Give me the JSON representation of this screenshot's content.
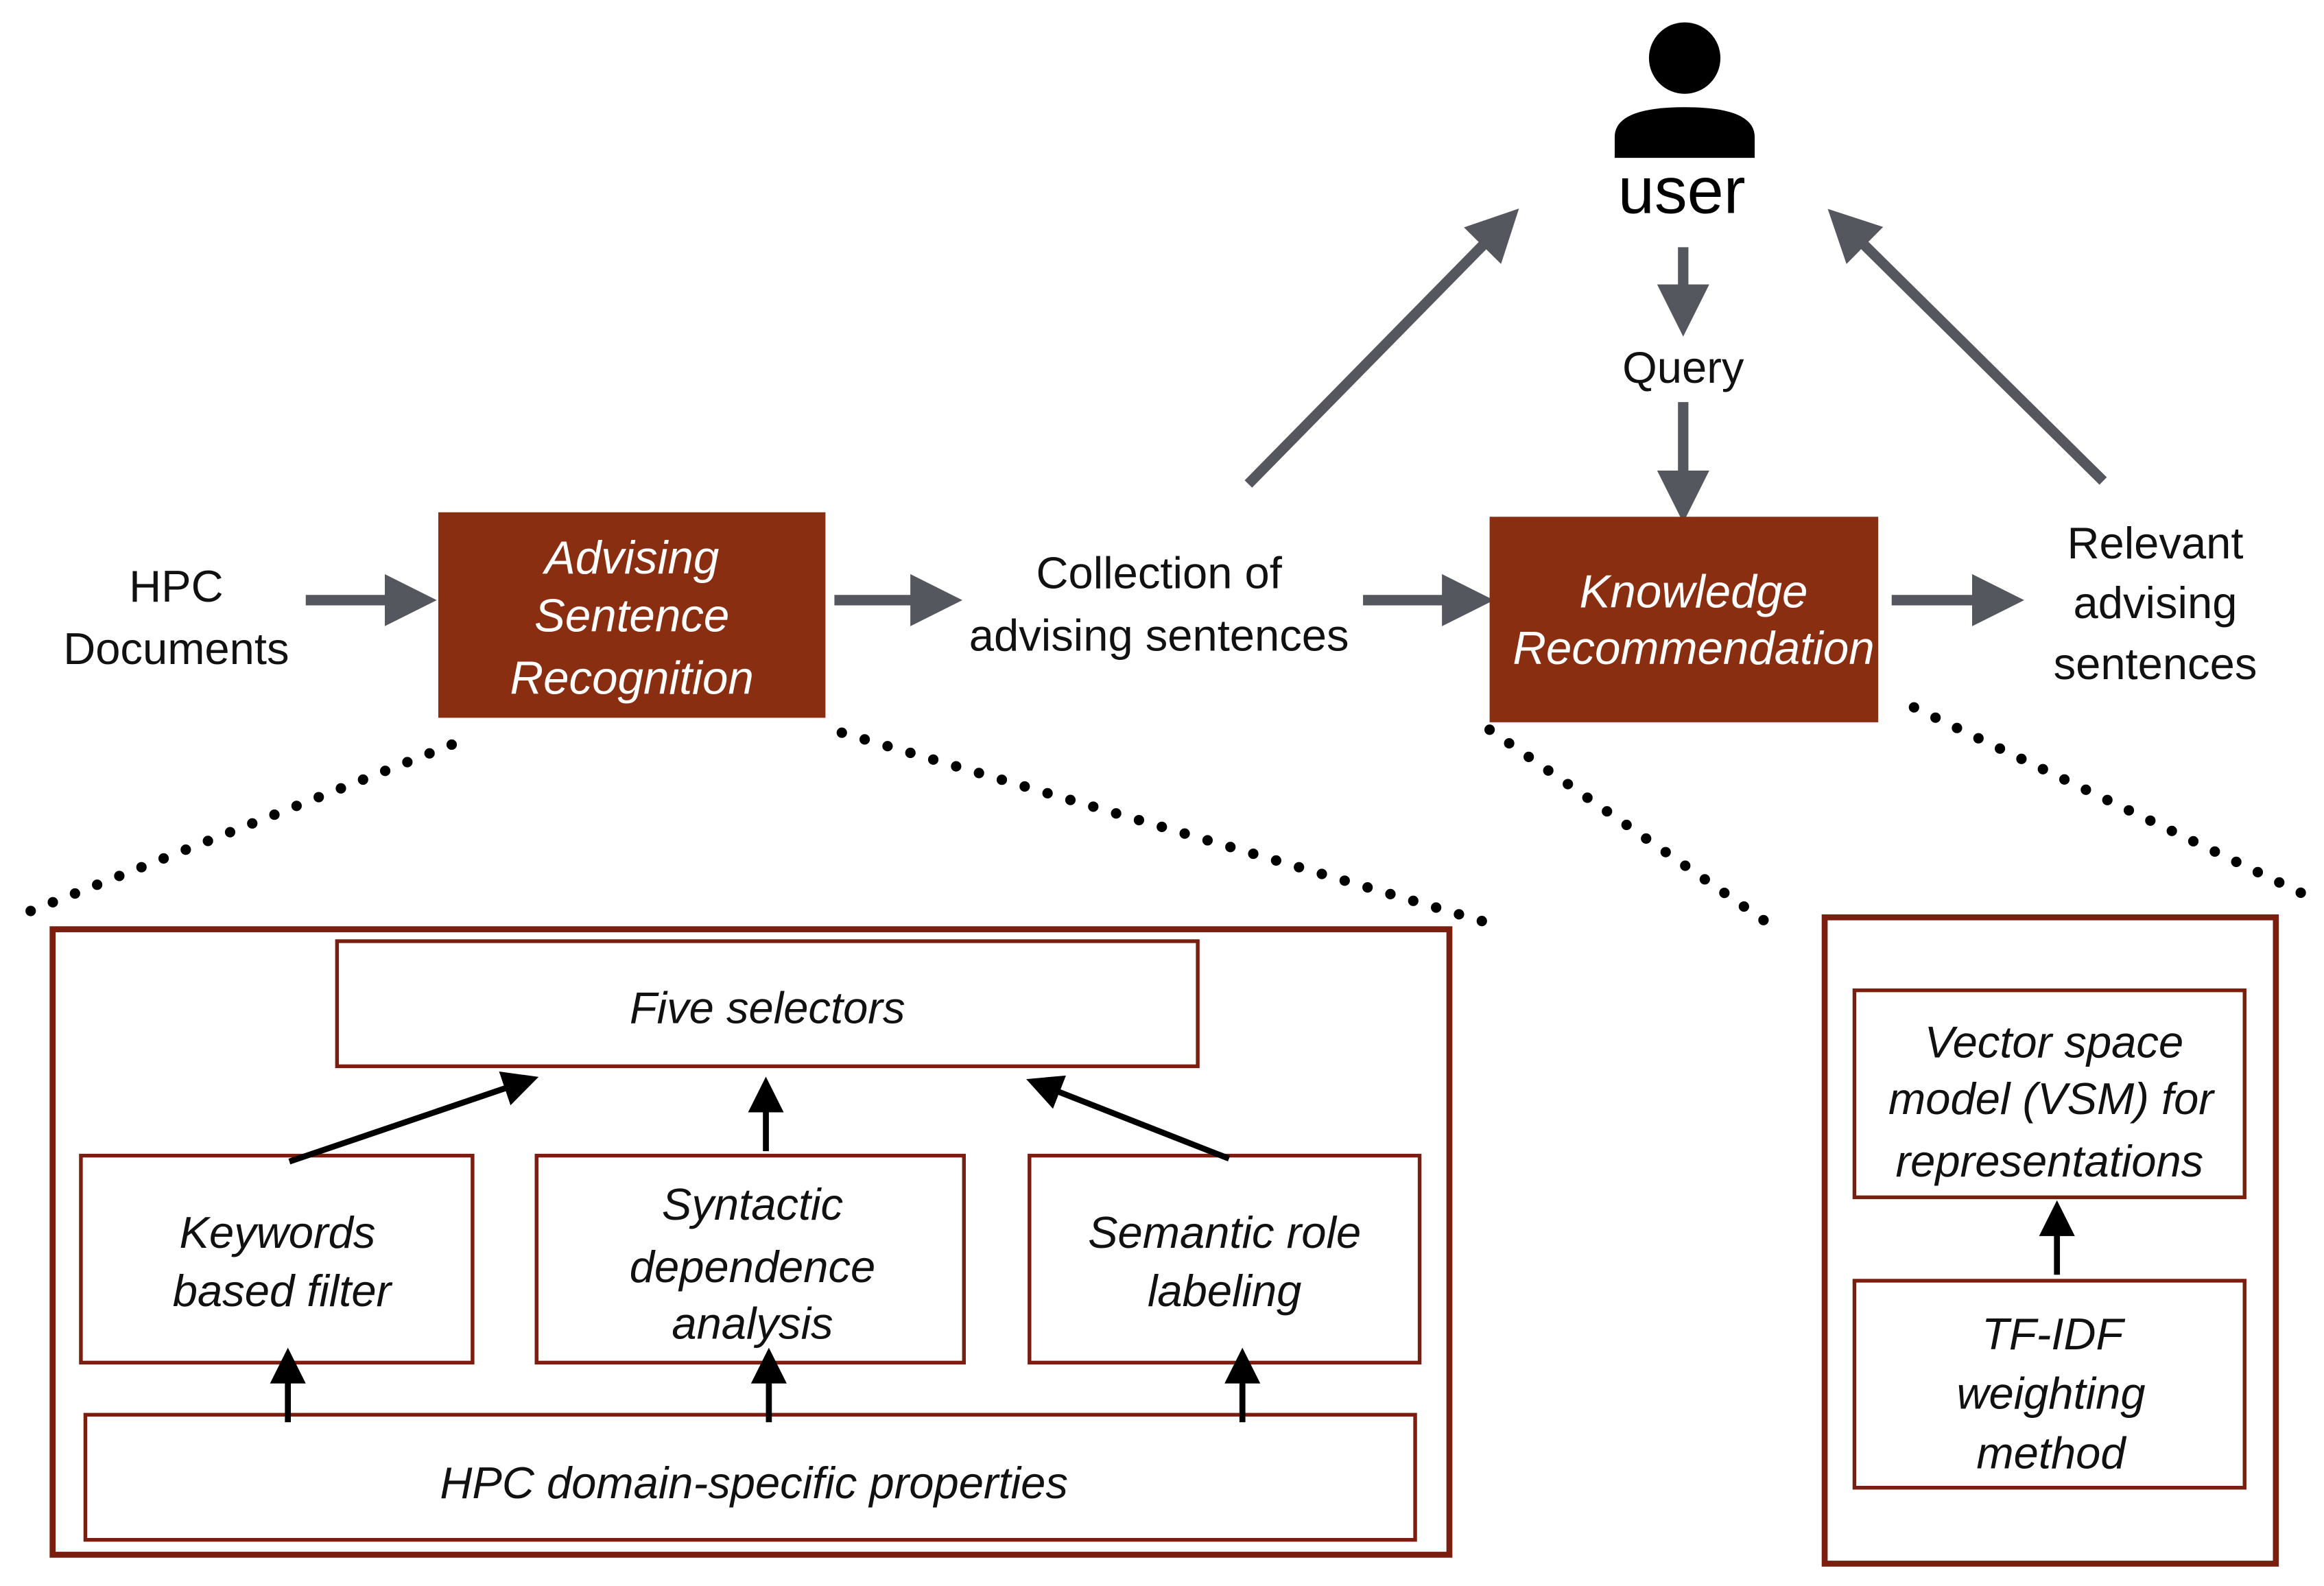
{
  "colors": {
    "process_box": "#8a2e12",
    "arrow_gray": "#54575e",
    "border": "#7a1f10"
  },
  "user": {
    "icon": "person-icon",
    "label": "user",
    "query_label": "Query"
  },
  "inputs": {
    "hpc_documents": [
      "HPC",
      "Documents"
    ]
  },
  "asr": {
    "label": [
      "Advising",
      "Sentence",
      "Recognition"
    ]
  },
  "collection": {
    "label": [
      "Collection of",
      "advising sentences"
    ]
  },
  "kr": {
    "label": [
      "Knowledge",
      "Recommendation"
    ]
  },
  "output": {
    "label": [
      "Relevant",
      "advising",
      "sentences"
    ]
  },
  "asr_detail": {
    "five_selectors": "Five selectors",
    "keywords": [
      "Keywords",
      "based filter"
    ],
    "syntactic": [
      "Syntactic",
      "dependence",
      "analysis"
    ],
    "semantic": [
      "Semantic role",
      "labeling"
    ],
    "properties": "HPC domain-specific properties"
  },
  "kr_detail": {
    "vsm": [
      "Vector space",
      "model (VSM) for",
      "representations"
    ],
    "tfidf": [
      "TF-IDF",
      "weighting",
      "method"
    ]
  }
}
